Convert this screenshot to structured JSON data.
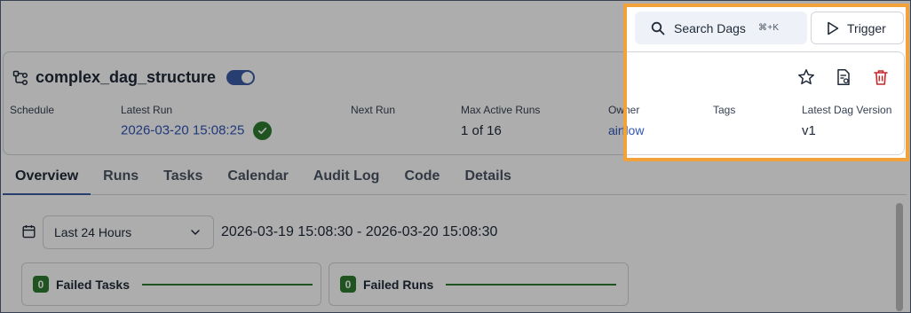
{
  "topbar": {
    "search_label": "Search Dags",
    "search_shortcut": "⌘+K",
    "trigger_label": "Trigger"
  },
  "dag": {
    "title": "complex_dag_structure",
    "toggle_enabled": true
  },
  "meta": {
    "schedule_label": "Schedule",
    "latest_run_label": "Latest Run",
    "latest_run_value": "2026-03-20 15:08:25",
    "latest_run_status": "success",
    "next_run_label": "Next Run",
    "max_active_runs_label": "Max Active Runs",
    "max_active_runs_value": "1 of 16",
    "owner_label": "Owner",
    "owner_value": "airflow",
    "tags_label": "Tags",
    "latest_version_label": "Latest Dag Version",
    "latest_version_value": "v1"
  },
  "tabs": [
    "Overview",
    "Runs",
    "Tasks",
    "Calendar",
    "Audit Log",
    "Code",
    "Details"
  ],
  "active_tab": "Overview",
  "filter": {
    "range_select_value": "Last 24 Hours",
    "range_text": "2026-03-19 15:08:30 - 2026-03-20 15:08:30"
  },
  "stats": [
    {
      "count": "0",
      "label": "Failed Tasks"
    },
    {
      "count": "0",
      "label": "Failed Runs"
    }
  ],
  "colors": {
    "accent": "#3b5ba5",
    "link": "#2f55b6",
    "success": "#2f7d32",
    "danger": "#c62828",
    "highlight": "#f2a23a"
  }
}
